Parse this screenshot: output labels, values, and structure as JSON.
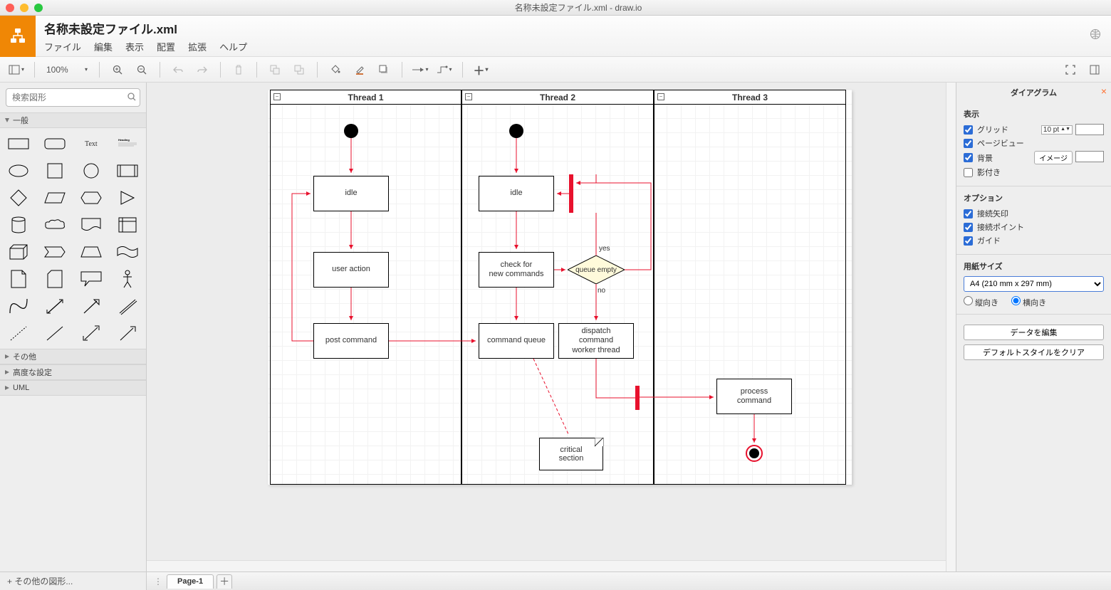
{
  "mac": {
    "title": "名称未設定ファイル.xml - draw.io"
  },
  "header": {
    "doc_title": "名称未設定ファイル.xml",
    "menu": [
      "ファイル",
      "編集",
      "表示",
      "配置",
      "拡張",
      "ヘルプ"
    ]
  },
  "toolbar": {
    "zoom": "100%"
  },
  "left": {
    "search_placeholder": "検索図形",
    "sections": {
      "general": "一般",
      "other": "その他",
      "advanced": "高度な設定",
      "uml": "UML"
    },
    "more_shapes": "+ その他の図形..."
  },
  "right": {
    "title": "ダイアグラム",
    "s_view": "表示",
    "grid": "グリッド",
    "grid_size": "10 pt",
    "pageview": "ページビュー",
    "background": "背景",
    "image_btn": "イメージ",
    "shadow": "影付き",
    "s_options": "オプション",
    "conn_arrows": "接続矢印",
    "conn_points": "接続ポイント",
    "guides": "ガイド",
    "s_paper": "用紙サイズ",
    "paper": "A4 (210 mm x 297 mm)",
    "portrait": "縦向き",
    "landscape": "横向き",
    "edit_data": "データを編集",
    "clear_style": "デフォルトスタイルをクリア"
  },
  "tabs": {
    "page1": "Page-1"
  },
  "diagram": {
    "lane1": "Thread 1",
    "lane2": "Thread 2",
    "lane3": "Thread 3",
    "l1_idle": "idle",
    "l1_user": "user action",
    "l1_post": "post command",
    "l2_idle": "idle",
    "l2_check": "check for\nnew commands",
    "l2_queue": "command queue",
    "l2_dispatch": "dispatch\ncommand\nworker thread",
    "l2_decision": "queue empty",
    "l2_yes": "yes",
    "l2_no": "no",
    "l2_critical": "critical\nsection",
    "l3_process": "process\ncommand"
  }
}
